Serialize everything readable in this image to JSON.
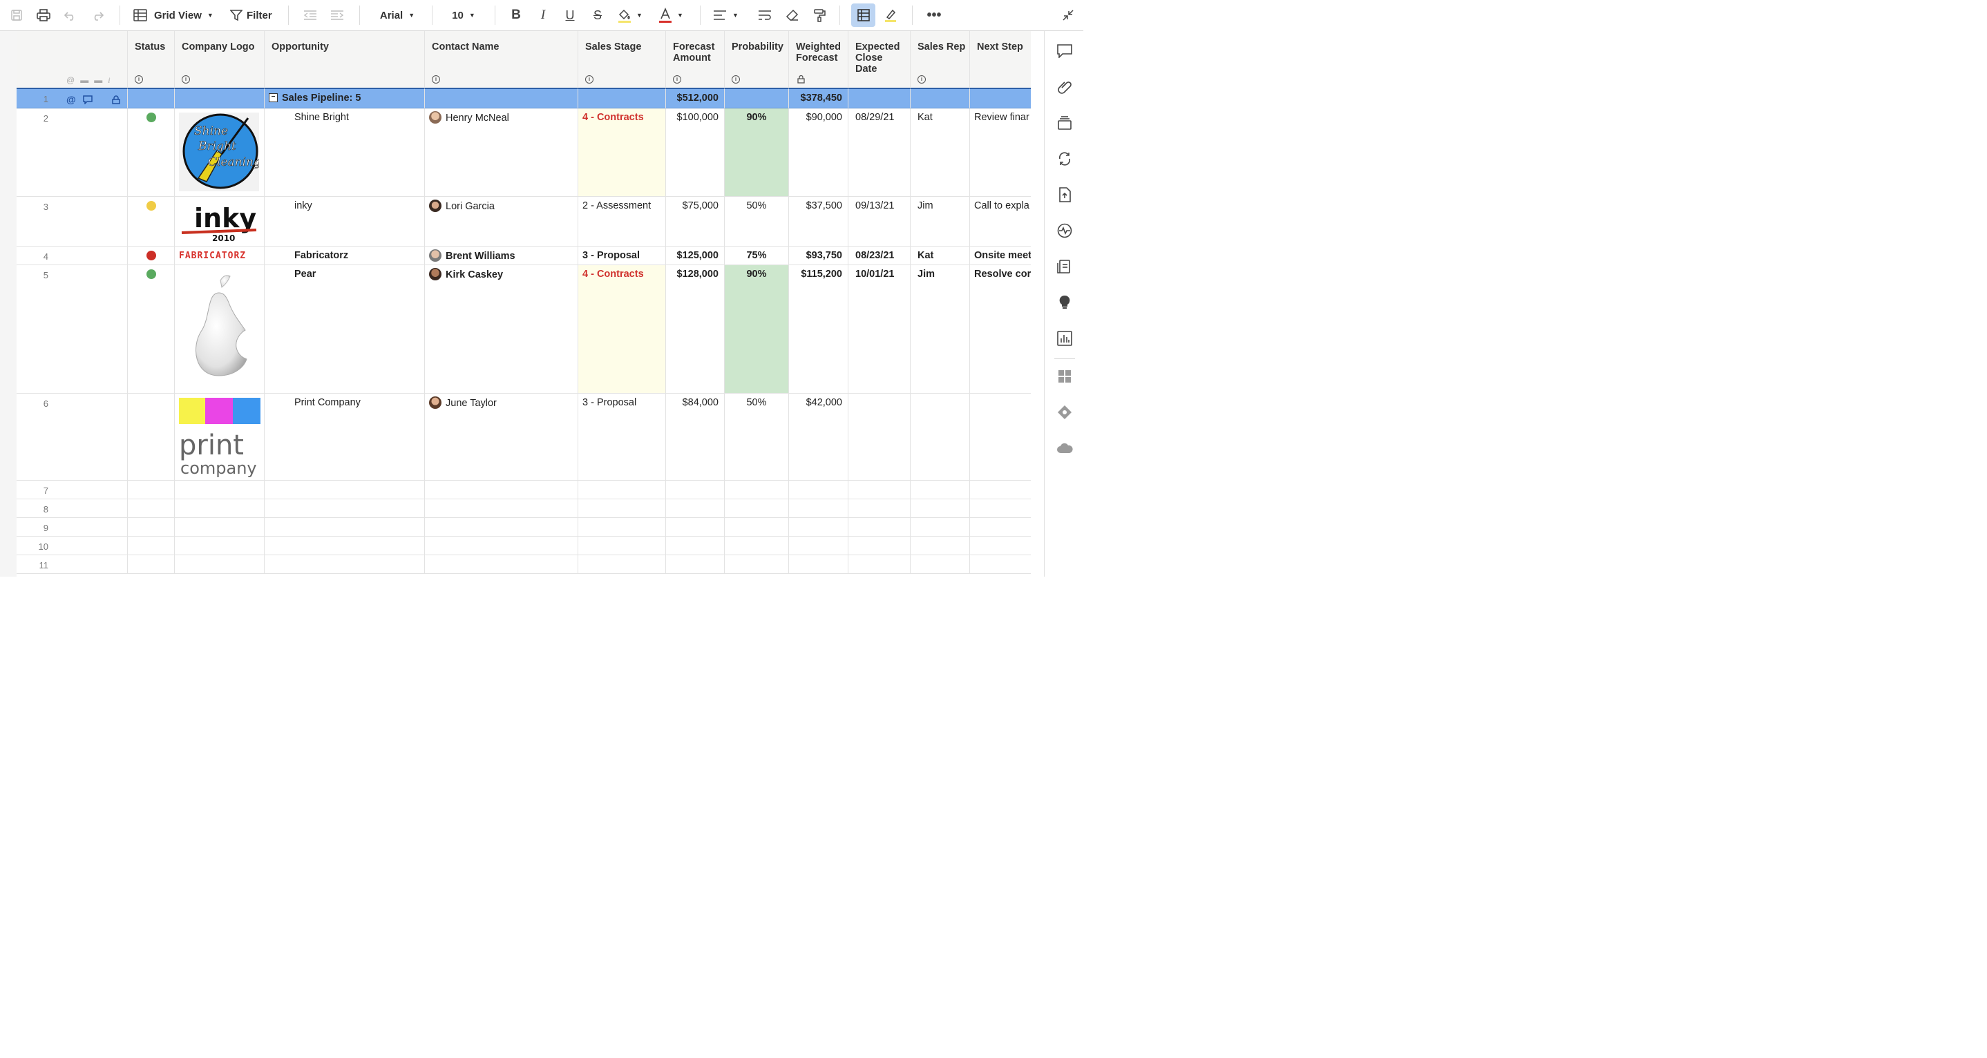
{
  "toolbar": {
    "view_label": "Grid View",
    "filter_label": "Filter",
    "font_name": "Arial",
    "font_size": "10",
    "accent_color": "#bcd4f2"
  },
  "columns": [
    {
      "key": "status",
      "label": "Status"
    },
    {
      "key": "logo",
      "label": "Company Logo"
    },
    {
      "key": "opportunity",
      "label": "Opportunity"
    },
    {
      "key": "contact",
      "label": "Contact Name"
    },
    {
      "key": "stage",
      "label": "Sales Stage"
    },
    {
      "key": "forecast",
      "label": "Forecast Amount"
    },
    {
      "key": "probability",
      "label": "Probability"
    },
    {
      "key": "weighted",
      "label": "Weighted Forecast"
    },
    {
      "key": "close",
      "label": "Expected Close Date"
    },
    {
      "key": "rep",
      "label": "Sales Rep"
    },
    {
      "key": "next",
      "label": "Next Step"
    }
  ],
  "parent_row": {
    "num": "1",
    "title": "Sales Pipeline: 5",
    "forecast": "$512,000",
    "weighted": "$378,450"
  },
  "rows": [
    {
      "num": "2",
      "status_color": "#5aaa5f",
      "logo": "Shine Bright Cleaning",
      "opportunity": "Shine Bright",
      "contact": "Henry McNeal",
      "stage": "4 - Contracts",
      "forecast": "$100,000",
      "probability": "90%",
      "weighted": "$90,000",
      "close": "08/29/21",
      "rep": "Kat",
      "next": "Review finar"
    },
    {
      "num": "3",
      "status_color": "#f0cc45",
      "logo": "inky 2010",
      "opportunity": "inky",
      "contact": "Lori Garcia",
      "stage": "2 - Assessment",
      "forecast": "$75,000",
      "probability": "50%",
      "weighted": "$37,500",
      "close": "09/13/21",
      "rep": "Jim",
      "next": "Call to expla"
    },
    {
      "num": "4",
      "status_color": "#cc2f27",
      "logo": "FABRICATORZ",
      "opportunity": "Fabricatorz",
      "contact": "Brent Williams",
      "stage": "3 - Proposal",
      "forecast": "$125,000",
      "probability": "75%",
      "weighted": "$93,750",
      "close": "08/23/21",
      "rep": "Kat",
      "next": "Onsite meet"
    },
    {
      "num": "5",
      "status_color": "#5aaa5f",
      "logo": "Pear",
      "opportunity": "Pear",
      "contact": "Kirk Caskey",
      "stage": "4 - Contracts",
      "forecast": "$128,000",
      "probability": "90%",
      "weighted": "$115,200",
      "close": "10/01/21",
      "rep": "Jim",
      "next": "Resolve cor"
    },
    {
      "num": "6",
      "status_color": "",
      "logo": "print company",
      "opportunity": "Print Company",
      "contact": "June Taylor",
      "stage": "3 - Proposal",
      "forecast": "$84,000",
      "probability": "50%",
      "weighted": "$42,000",
      "close": "",
      "rep": "",
      "next": ""
    }
  ],
  "empty_rows": [
    "7",
    "8",
    "9",
    "10",
    "11"
  ],
  "logos": {
    "shine": [
      "Shine",
      "Bright",
      "Cleaning"
    ],
    "inky": [
      "inky",
      "2010"
    ],
    "fabricatorz": "FABRICATORZ",
    "print": [
      "print",
      "company"
    ]
  }
}
